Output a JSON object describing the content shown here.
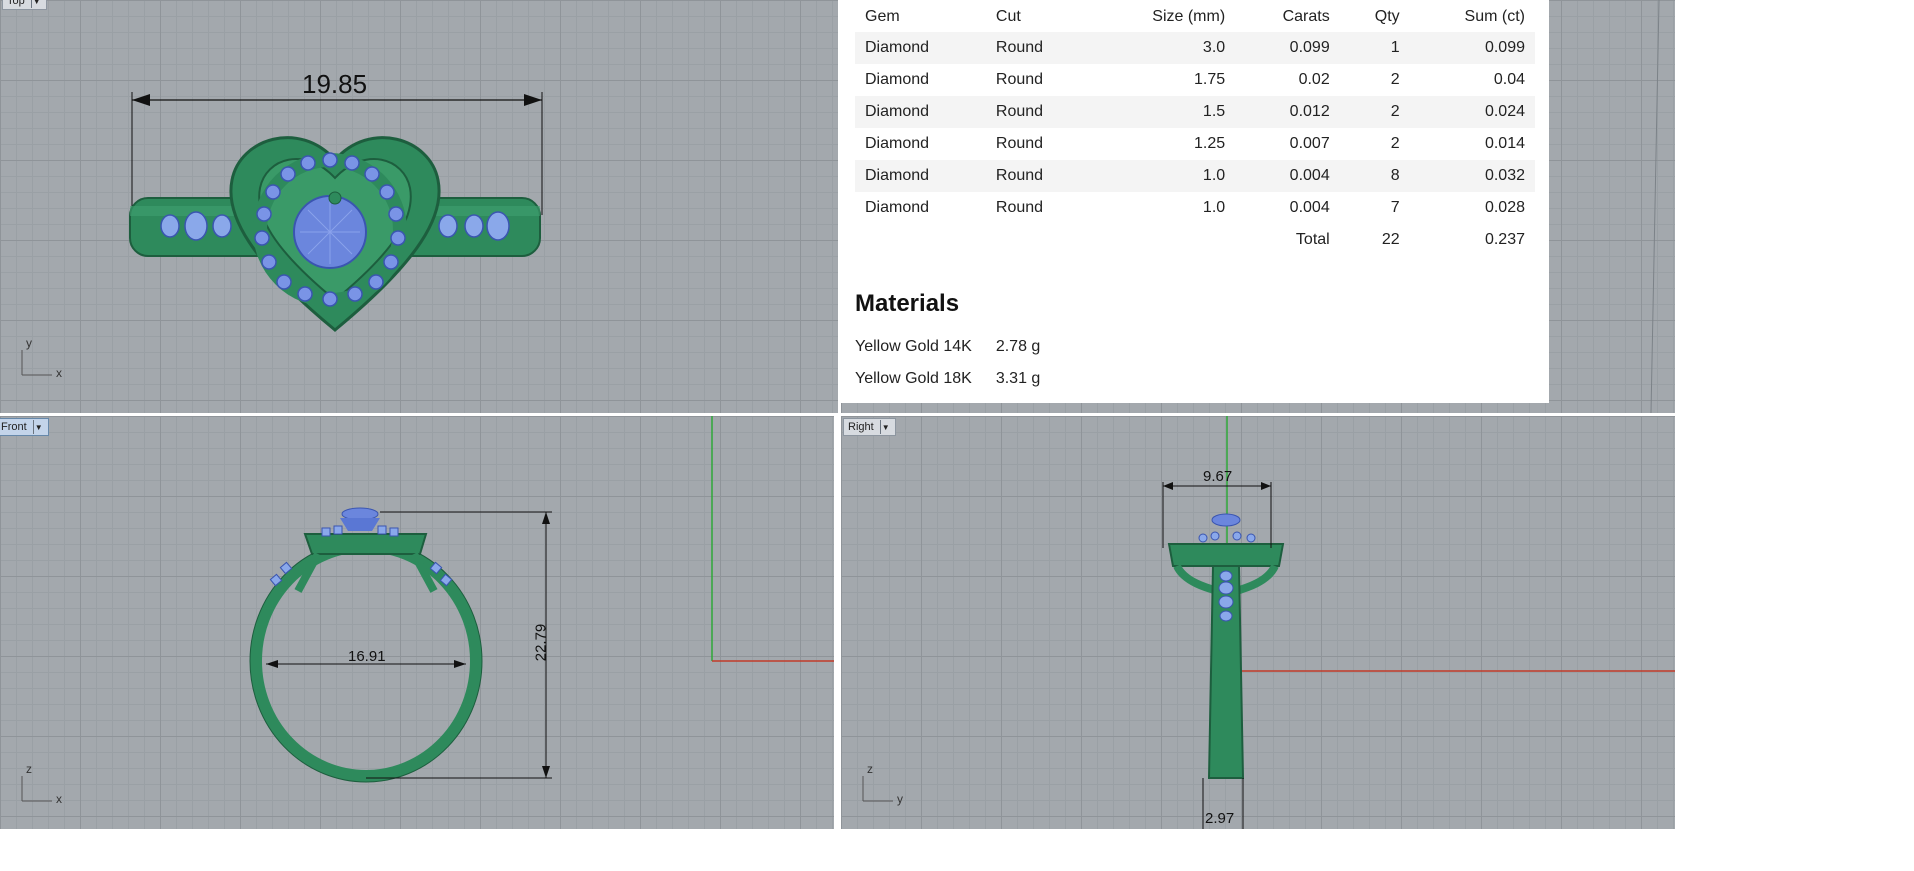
{
  "viewports": {
    "top": {
      "label": "Top",
      "dimension": "19.85",
      "axes": {
        "v": "y",
        "h": "x"
      }
    },
    "front": {
      "label": "Front",
      "dimension_width": "16.91",
      "dimension_height": "22.79",
      "axes": {
        "v": "z",
        "h": "x"
      }
    },
    "right": {
      "label": "Right",
      "dimension_width": "9.67",
      "dimension_bottom": "2.97",
      "axes": {
        "v": "z",
        "h": "y"
      }
    }
  },
  "gem_table": {
    "headers": [
      "Gem",
      "Cut",
      "Size (mm)",
      "Carats",
      "Qty",
      "Sum (ct)"
    ],
    "rows": [
      [
        "Diamond",
        "Round",
        "3.0",
        "0.099",
        "1",
        "0.099"
      ],
      [
        "Diamond",
        "Round",
        "1.75",
        "0.02",
        "2",
        "0.04"
      ],
      [
        "Diamond",
        "Round",
        "1.5",
        "0.012",
        "2",
        "0.024"
      ],
      [
        "Diamond",
        "Round",
        "1.25",
        "0.007",
        "2",
        "0.014"
      ],
      [
        "Diamond",
        "Round",
        "1.0",
        "0.004",
        "8",
        "0.032"
      ],
      [
        "Diamond",
        "Round",
        "1.0",
        "0.004",
        "7",
        "0.028"
      ]
    ],
    "total": {
      "label": "Total",
      "qty": "22",
      "sum": "0.237"
    }
  },
  "materials": {
    "title": "Materials",
    "items": [
      {
        "name": "Yellow Gold 14K",
        "weight": "2.78 g"
      },
      {
        "name": "Yellow Gold 18K",
        "weight": "3.31 g"
      }
    ]
  },
  "colors": {
    "metal": "#2e8a5c",
    "gem": "#6b86dd",
    "viewport_bg": "#a3a8ad"
  }
}
